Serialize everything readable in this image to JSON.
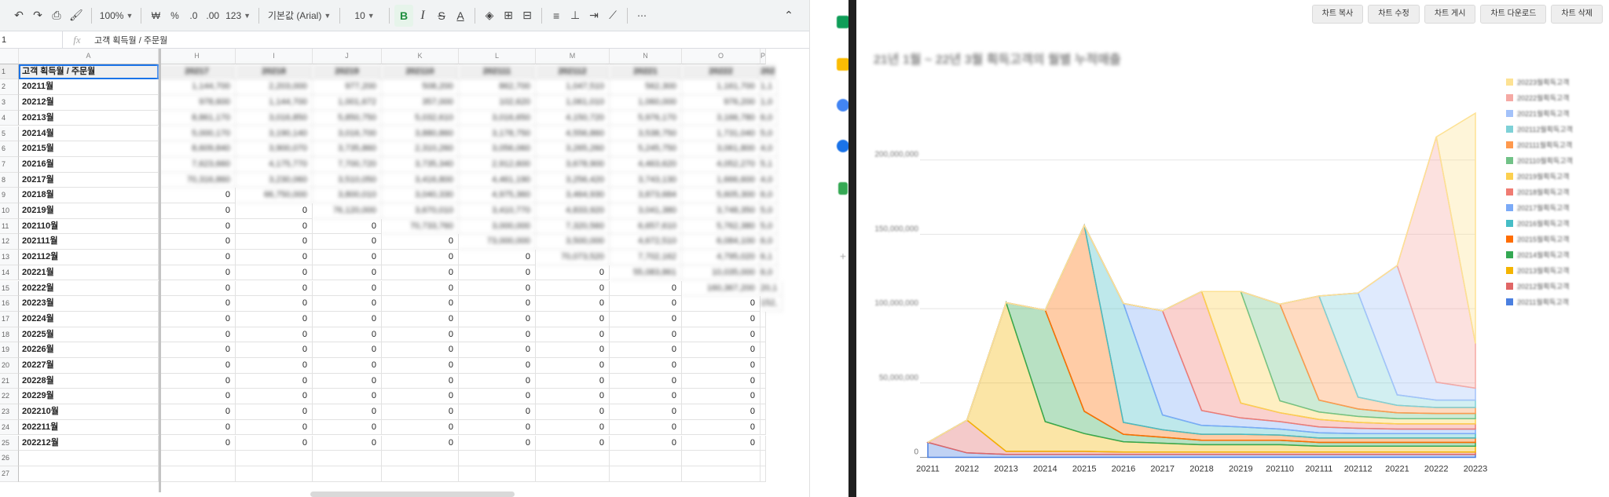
{
  "toolbar": {
    "zoom": "100%",
    "font": "기본값 (Arial)",
    "font_size": "10",
    "currency": "₩",
    "percent": "%",
    "dec_decrease": ".0",
    "dec_increase": ".00",
    "number_format": "123",
    "more": "⋯"
  },
  "formula_bar": {
    "name_box": "1",
    "fx": "fx",
    "value": "고객 획득월 / 주문월"
  },
  "columns": [
    "A",
    "H",
    "I",
    "J",
    "K",
    "L",
    "M",
    "N",
    "O",
    "P"
  ],
  "header_row": [
    "고객 획득월 / 주문월",
    "20217",
    "20218",
    "20219",
    "202110",
    "202111",
    "202112",
    "20221",
    "20222",
    "202"
  ],
  "rows": [
    {
      "n": "2",
      "label": "20211월",
      "cells": [
        "1,144,700",
        "2,203,000",
        "977,200",
        "508,200",
        "862,700",
        "1,047,510",
        "562,300",
        "1,161,700",
        "1,1"
      ]
    },
    {
      "n": "3",
      "label": "20212월",
      "cells": [
        "978,600",
        "1,144,700",
        "1,001,672",
        "357,000",
        "102,620",
        "1,061,010",
        "1,060,000",
        "976,200",
        "1,0"
      ]
    },
    {
      "n": "4",
      "label": "20213월",
      "cells": [
        "8,861,170",
        "3,016,850",
        "5,850,750",
        "5,032,610",
        "3,016,650",
        "4,150,720",
        "5,976,170",
        "3,166,780",
        "6,0"
      ]
    },
    {
      "n": "5",
      "label": "20214월",
      "cells": [
        "5,000,170",
        "3,190,140",
        "3,016,700",
        "3,880,860",
        "3,178,750",
        "4,556,860",
        "3,538,750",
        "1,731,040",
        "5,0"
      ]
    },
    {
      "n": "6",
      "label": "20215월",
      "cells": [
        "8,609,840",
        "3,900,070",
        "3,735,860",
        "2,310,260",
        "3,056,060",
        "3,265,260",
        "5,245,750",
        "3,061,800",
        "4,0"
      ]
    },
    {
      "n": "7",
      "label": "20216월",
      "cells": [
        "7,623,660",
        "4,175,770",
        "7,700,720",
        "3,735,340",
        "2,912,600",
        "3,678,900",
        "4,463,620",
        "4,052,270",
        "5,1"
      ]
    },
    {
      "n": "8",
      "label": "20217월",
      "cells": [
        "70,316,860",
        "3,230,060",
        "3,510,050",
        "3,416,800",
        "4,461,190",
        "3,256,420",
        "3,743,130",
        "1,666,600",
        "4,0"
      ]
    },
    {
      "n": "9",
      "label": "20218월",
      "cells": [
        "0",
        "66,750,000",
        "3,800,010",
        "3,040,330",
        "4,975,360",
        "3,464,930",
        "3,873,684",
        "5,605,300",
        "6,0"
      ]
    },
    {
      "n": "10",
      "label": "20219월",
      "cells": [
        "0",
        "0",
        "76,120,000",
        "3,670,010",
        "3,410,770",
        "4,833,920",
        "3,041,380",
        "3,748,350",
        "5,0"
      ]
    },
    {
      "n": "11",
      "label": "202110월",
      "cells": [
        "0",
        "0",
        "0",
        "70,733,760",
        "3,000,000",
        "7,320,560",
        "6,657,610",
        "5,762,380",
        "5,0"
      ]
    },
    {
      "n": "12",
      "label": "202111월",
      "cells": [
        "0",
        "0",
        "0",
        "0",
        "73,000,000",
        "3,500,000",
        "4,672,510",
        "6,084,100",
        "6,0"
      ]
    },
    {
      "n": "13",
      "label": "202112월",
      "cells": [
        "0",
        "0",
        "0",
        "0",
        "0",
        "70,073,520",
        "7,702,162",
        "4,795,020",
        "6,1"
      ]
    },
    {
      "n": "14",
      "label": "20221월",
      "cells": [
        "0",
        "0",
        "0",
        "0",
        "0",
        "0",
        "55,083,861",
        "10,035,000",
        "6,0"
      ]
    },
    {
      "n": "15",
      "label": "20222월",
      "cells": [
        "0",
        "0",
        "0",
        "0",
        "0",
        "0",
        "0",
        "160,367,200",
        "20,1"
      ]
    },
    {
      "n": "16",
      "label": "20223월",
      "cells": [
        "0",
        "0",
        "0",
        "0",
        "0",
        "0",
        "0",
        "0",
        "152,"
      ]
    },
    {
      "n": "17",
      "label": "20224월",
      "cells": [
        "0",
        "0",
        "0",
        "0",
        "0",
        "0",
        "0",
        "0",
        ""
      ]
    },
    {
      "n": "18",
      "label": "20225월",
      "cells": [
        "0",
        "0",
        "0",
        "0",
        "0",
        "0",
        "0",
        "0",
        ""
      ]
    },
    {
      "n": "19",
      "label": "20226월",
      "cells": [
        "0",
        "0",
        "0",
        "0",
        "0",
        "0",
        "0",
        "0",
        ""
      ]
    },
    {
      "n": "20",
      "label": "20227월",
      "cells": [
        "0",
        "0",
        "0",
        "0",
        "0",
        "0",
        "0",
        "0",
        ""
      ]
    },
    {
      "n": "21",
      "label": "20228월",
      "cells": [
        "0",
        "0",
        "0",
        "0",
        "0",
        "0",
        "0",
        "0",
        ""
      ]
    },
    {
      "n": "22",
      "label": "20229월",
      "cells": [
        "0",
        "0",
        "0",
        "0",
        "0",
        "0",
        "0",
        "0",
        ""
      ]
    },
    {
      "n": "23",
      "label": "202210월",
      "cells": [
        "0",
        "0",
        "0",
        "0",
        "0",
        "0",
        "0",
        "0",
        ""
      ]
    },
    {
      "n": "24",
      "label": "202211월",
      "cells": [
        "0",
        "0",
        "0",
        "0",
        "0",
        "0",
        "0",
        "0",
        ""
      ]
    },
    {
      "n": "25",
      "label": "202212월",
      "cells": [
        "0",
        "0",
        "0",
        "0",
        "0",
        "0",
        "0",
        "0",
        ""
      ]
    },
    {
      "n": "26",
      "label": "",
      "cells": [
        "",
        "",
        "",
        "",
        "",
        "",
        "",
        "",
        ""
      ]
    },
    {
      "n": "27",
      "label": "",
      "cells": [
        "",
        "",
        "",
        "",
        "",
        "",
        "",
        "",
        ""
      ]
    }
  ],
  "chart_panel": {
    "buttons": [
      "차트 복사",
      "차트 수정",
      "차트 게시",
      "차트 다운로드",
      "차트 삭제"
    ],
    "colors": {
      "accent": "#1a73e8",
      "panel_bg": "#ffffff",
      "divider": "#1f1f1f"
    }
  },
  "side_icons": [
    "sheets-icon",
    "keep-icon",
    "tasks-icon",
    "contacts-icon",
    "maps-icon",
    "more-icon"
  ],
  "chart_data": {
    "type": "area",
    "title": "21년 1월 ~ 22년 3월 획득고객의 월별 누적매출",
    "x": [
      "20211",
      "20212",
      "20213",
      "20214",
      "20215",
      "20216",
      "20217",
      "20218",
      "20219",
      "202110",
      "202111",
      "202112",
      "20221",
      "20222",
      "20223"
    ],
    "ylim": [
      0,
      200000000
    ],
    "yticks": [
      "0",
      "50,000,000",
      "100,000,000",
      "150,000,000",
      "200,000,000"
    ],
    "grid": true,
    "legend_position": "right",
    "series": [
      {
        "name": "20211월획득고객",
        "color": "#4a7fe0",
        "values": [
          10000000,
          3000000,
          2000000,
          2000000,
          2000000,
          2000000,
          2000000,
          2000000,
          2000000,
          2000000,
          2000000,
          2000000,
          2000000,
          2000000,
          2000000
        ]
      },
      {
        "name": "20212월획득고객",
        "color": "#e06666",
        "values": [
          0,
          22000000,
          2000000,
          2000000,
          2000000,
          1500000,
          1500000,
          1500000,
          1500000,
          1500000,
          1500000,
          1500000,
          1500000,
          1500000,
          1500000
        ]
      },
      {
        "name": "20213월획득고객",
        "color": "#f4b400",
        "values": [
          0,
          0,
          100000000,
          20000000,
          12000000,
          7000000,
          6000000,
          5000000,
          5000000,
          5000000,
          4000000,
          4000000,
          4000000,
          4000000,
          4000000
        ]
      },
      {
        "name": "20214월획득고객",
        "color": "#34a853",
        "values": [
          0,
          0,
          0,
          75000000,
          15000000,
          5000000,
          4000000,
          3000000,
          3000000,
          3000000,
          2500000,
          2500000,
          2500000,
          2500000,
          2500000
        ]
      },
      {
        "name": "20215월획득고객",
        "color": "#ff6d01",
        "values": [
          0,
          0,
          0,
          0,
          125000000,
          8000000,
          5000000,
          4000000,
          4000000,
          3500000,
          3000000,
          3000000,
          3000000,
          3000000,
          3000000
        ]
      },
      {
        "name": "20216월획득고객",
        "color": "#46bdc6",
        "values": [
          0,
          0,
          0,
          0,
          0,
          80000000,
          10000000,
          6000000,
          5000000,
          4000000,
          3500000,
          3000000,
          3000000,
          3000000,
          3000000
        ]
      },
      {
        "name": "20217월획득고객",
        "color": "#7baaf7",
        "values": [
          0,
          0,
          0,
          0,
          0,
          0,
          70000000,
          10000000,
          6000000,
          5000000,
          4000000,
          3500000,
          3000000,
          3000000,
          3000000
        ]
      },
      {
        "name": "20218월획득고객",
        "color": "#f07b72",
        "values": [
          0,
          0,
          0,
          0,
          0,
          0,
          0,
          80000000,
          10000000,
          6000000,
          5000000,
          4000000,
          3500000,
          3500000,
          3500000
        ]
      },
      {
        "name": "20219월획득고객",
        "color": "#fcd04f",
        "values": [
          0,
          0,
          0,
          0,
          0,
          0,
          0,
          0,
          75000000,
          8000000,
          5000000,
          4000000,
          3500000,
          3500000,
          3500000
        ]
      },
      {
        "name": "202110월획득고객",
        "color": "#71c287",
        "values": [
          0,
          0,
          0,
          0,
          0,
          0,
          0,
          0,
          0,
          65000000,
          8000000,
          5000000,
          4000000,
          3500000,
          3500000
        ]
      },
      {
        "name": "202111월획득고객",
        "color": "#ff994d",
        "values": [
          0,
          0,
          0,
          0,
          0,
          0,
          0,
          0,
          0,
          0,
          70000000,
          8000000,
          5000000,
          4000000,
          4000000
        ]
      },
      {
        "name": "202112월획득고객",
        "color": "#7ed1d7",
        "values": [
          0,
          0,
          0,
          0,
          0,
          0,
          0,
          0,
          0,
          0,
          0,
          70000000,
          7000000,
          5000000,
          5000000
        ]
      },
      {
        "name": "20221월획득고객",
        "color": "#a3c2fa",
        "values": [
          0,
          0,
          0,
          0,
          0,
          0,
          0,
          0,
          0,
          0,
          0,
          0,
          87000000,
          12000000,
          8000000
        ]
      },
      {
        "name": "20222월획득고객",
        "color": "#f5a9a4",
        "values": [
          0,
          0,
          0,
          0,
          0,
          0,
          0,
          0,
          0,
          0,
          0,
          0,
          0,
          165000000,
          30000000
        ]
      },
      {
        "name": "20223월획득고객",
        "color": "#fde293",
        "values": [
          0,
          0,
          0,
          0,
          0,
          0,
          0,
          0,
          0,
          0,
          0,
          0,
          0,
          0,
          155000000
        ]
      }
    ]
  }
}
